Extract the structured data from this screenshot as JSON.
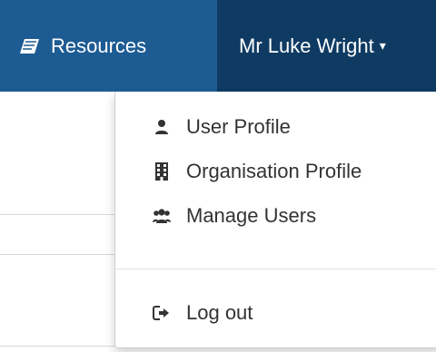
{
  "navbar": {
    "resources_label": "Resources",
    "user_label": "Mr Luke Wright",
    "icons": {
      "resources": "book-icon",
      "user_caret": "caret-down-icon"
    }
  },
  "dropdown": {
    "items": [
      {
        "label": "User Profile",
        "icon": "user-icon"
      },
      {
        "label": "Organisation Profile",
        "icon": "building-icon"
      },
      {
        "label": "Manage Users",
        "icon": "users-icon"
      },
      {
        "label": "Log out",
        "icon": "sign-out-icon"
      }
    ]
  },
  "colors": {
    "navbar_bg": "#0f3b63",
    "resources_bg": "#1d5b93",
    "text_dark": "#333333",
    "white": "#ffffff"
  }
}
